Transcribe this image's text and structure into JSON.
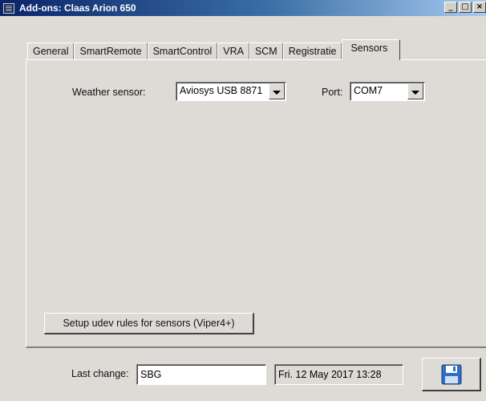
{
  "window": {
    "title": "Add-ons: Claas Arion 650",
    "icons": {
      "app": "window-icon",
      "minimize": "minimize-icon",
      "maximize": "maximize-icon",
      "close": "close-icon"
    },
    "minimize_glyph": "_",
    "maximize_glyph": "□",
    "close_glyph": "×"
  },
  "tabs": [
    {
      "label": "General",
      "active": false
    },
    {
      "label": "SmartRemote",
      "active": false
    },
    {
      "label": "SmartControl",
      "active": false
    },
    {
      "label": "VRA",
      "active": false
    },
    {
      "label": "SCM",
      "active": false
    },
    {
      "label": "Registratie",
      "active": false
    },
    {
      "label": "Sensors",
      "active": true
    }
  ],
  "sensors": {
    "weather_sensor_label": "Weather sensor:",
    "weather_sensor_value": "Aviosys USB 8871",
    "port_label": "Port:",
    "port_value": "COM7",
    "setup_button_label": "Setup udev rules for sensors (Viper4+)"
  },
  "footer": {
    "last_change_label": "Last change:",
    "last_change_user": "SBG",
    "last_change_date": "Fri. 12 May 2017 13:28",
    "save_icon": "floppy-disk-icon"
  },
  "colors": {
    "titlebar_start": "#0a246a",
    "titlebar_end": "#a6caf0",
    "background": "#dedbd6",
    "save_icon_blue": "#2f6fc6"
  }
}
